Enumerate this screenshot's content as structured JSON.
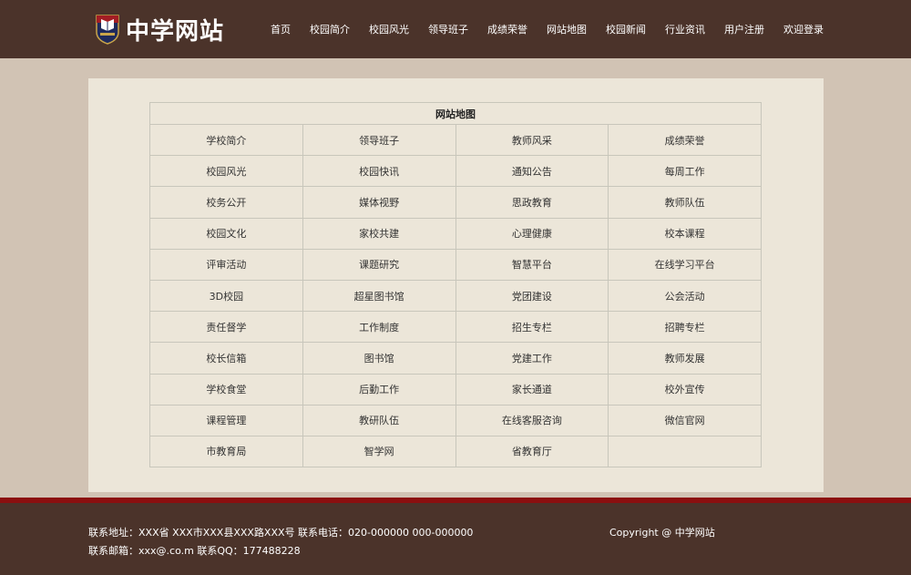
{
  "header": {
    "site_name": "中学网站",
    "nav": [
      "首页",
      "校园简介",
      "校园风光",
      "领导班子",
      "成绩荣誉",
      "网站地图",
      "校园新闻",
      "行业资讯",
      "用户注册",
      "欢迎登录"
    ]
  },
  "sitemap": {
    "title": "网站地图",
    "rows": [
      [
        "学校简介",
        "领导班子",
        "教师风采",
        "成绩荣誉"
      ],
      [
        "校园风光",
        "校园快讯",
        "通知公告",
        "每周工作"
      ],
      [
        "校务公开",
        "媒体视野",
        "思政教育",
        "教师队伍"
      ],
      [
        "校园文化",
        "家校共建",
        "心理健康",
        "校本课程"
      ],
      [
        "评审活动",
        "课题研究",
        "智慧平台",
        "在线学习平台"
      ],
      [
        "3D校园",
        "超星图书馆",
        "党团建设",
        "公会活动"
      ],
      [
        "责任督学",
        "工作制度",
        "招生专栏",
        "招聘专栏"
      ],
      [
        "校长信箱",
        "图书馆",
        "党建工作",
        "教师发展"
      ],
      [
        "学校食堂",
        "后勤工作",
        "家长通道",
        "校外宣传"
      ],
      [
        "课程管理",
        "教研队伍",
        "在线客服咨询",
        "微信官网"
      ],
      [
        "市教育局",
        "智学网",
        "省教育厅",
        ""
      ]
    ]
  },
  "footer": {
    "address": "联系地址：XXX省 XXX市XXX县XXX路XXX号 联系电话：020-000000 000-000000",
    "email": "联系邮箱：xxx@.co.m 联系QQ：177488228",
    "copyright": "Copyright @ 中学网站"
  },
  "colors": {
    "header_bg": "#4b332a",
    "page_bg": "#d1c3b4",
    "content_bg": "#ece6d9",
    "accent_red": "#8b0f0f"
  }
}
